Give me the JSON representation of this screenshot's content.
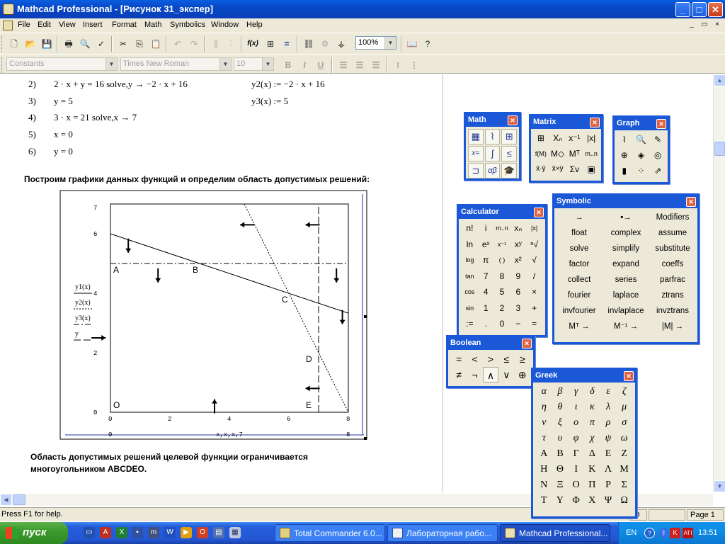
{
  "window": {
    "title": "Mathcad Professional - [Рисунок 31_экспер]",
    "minimize": "_",
    "maximize": "□",
    "close": "✕"
  },
  "menu": [
    "File",
    "Edit",
    "View",
    "Insert",
    "Format",
    "Math",
    "Symbolics",
    "Window",
    "Help"
  ],
  "mdi": {
    "minimize": "_",
    "restore": "▭",
    "close": "×"
  },
  "toolbar": {
    "zoom": "100%",
    "fx_label": "f(x)",
    "equals_label": "="
  },
  "format_bar": {
    "style": "Constants",
    "font": "Times New Roman",
    "size": "10",
    "bold": "B",
    "italic": "I",
    "underline": "U"
  },
  "equations": [
    {
      "num": "2)",
      "expr": "2 · x + y = 16 solve,y  → −2 · x + 16",
      "def": "y2(x) := −2 · x + 16"
    },
    {
      "num": "3)",
      "expr": "y = 5",
      "def": "y3(x) := 5"
    },
    {
      "num": "4)",
      "expr": "3 · x = 21 solve,x  → 7",
      "def": ""
    },
    {
      "num": "5)",
      "expr": "x = 0",
      "def": ""
    },
    {
      "num": "6)",
      "expr": "y = 0",
      "def": ""
    }
  ],
  "heading1": "Построим графики данных функций и определим область допустимых решений:",
  "conclusion": [
    "Область допустимых решений целевой функции ограничивается",
    "многоугольником ABCDEO."
  ],
  "chart_data": {
    "type": "line",
    "xlabel": "x,x,x,7",
    "ylabel_series": [
      "y1(x)",
      "y2(x)",
      "y3(x)",
      "y"
    ],
    "xlim": [
      0,
      8
    ],
    "ylim": [
      0,
      7
    ],
    "x_axis_labels": [
      "0",
      "8"
    ],
    "x_ticks": [
      "0",
      "2",
      "4",
      "6",
      "8"
    ],
    "y_ticks": [
      "0",
      "2",
      "4",
      "6"
    ],
    "y_top": "7",
    "series": [
      {
        "name": "y1(x)",
        "style": "solid",
        "points": [
          [
            0,
            6
          ],
          [
            8,
            3.33
          ]
        ]
      },
      {
        "name": "y2(x)",
        "style": "dotted",
        "points": [
          [
            4.5,
            7
          ],
          [
            8,
            0
          ]
        ]
      },
      {
        "name": "y3(x)",
        "style": "dashdot",
        "points": [
          [
            0,
            5
          ],
          [
            8,
            5
          ]
        ]
      },
      {
        "name": "y",
        "style": "dashed",
        "points": [
          [
            7,
            0
          ],
          [
            7,
            7
          ]
        ]
      }
    ],
    "points": [
      {
        "label": "A",
        "x": 0,
        "y": 5
      },
      {
        "label": "B",
        "x": 3,
        "y": 5
      },
      {
        "label": "C",
        "x": 6,
        "y": 4
      },
      {
        "label": "D",
        "x": 7,
        "y": 2
      },
      {
        "label": "E",
        "x": 7,
        "y": 0
      },
      {
        "label": "O",
        "x": 0,
        "y": 0
      }
    ],
    "arrows": [
      {
        "x": 0.6,
        "y": 5.6,
        "dir": "down"
      },
      {
        "x": 1.6,
        "y": 4.6,
        "dir": "down"
      },
      {
        "x": 4.6,
        "y": 6.3,
        "dir": "left"
      },
      {
        "x": 6.8,
        "y": 6.3,
        "dir": "left"
      },
      {
        "x": 7.6,
        "y": 4.6,
        "dir": "down"
      },
      {
        "x": 7.8,
        "y": 3.2,
        "dir": "down"
      },
      {
        "x": -0.4,
        "y": 2.5,
        "dir": "right"
      },
      {
        "x": 6.8,
        "y": 0.8,
        "dir": "left"
      },
      {
        "x": 3.5,
        "y": 0.2,
        "dir": "up"
      }
    ]
  },
  "palettes": {
    "math": {
      "title": "Math"
    },
    "matrix": {
      "title": "Matrix"
    },
    "graph": {
      "title": "Graph"
    },
    "calculator": {
      "title": "Calculator",
      "keys": [
        "n!",
        "i",
        "m..n",
        "xₙ",
        "|x|",
        "ln",
        "eˣ",
        "x⁻¹",
        "xʸ",
        "ⁿ√",
        "log",
        "π",
        "( )",
        "x²",
        "√",
        "tan",
        "7",
        "8",
        "9",
        "/",
        "cos",
        "4",
        "5",
        "6",
        "×",
        "sin",
        "1",
        "2",
        "3",
        "+",
        ":=",
        ".",
        "0",
        "−",
        "="
      ]
    },
    "symbolic": {
      "title": "Symbolic",
      "keys": [
        "→",
        "▪→",
        "Modifiers",
        "float",
        "complex",
        "assume",
        "solve",
        "simplify",
        "substitute",
        "factor",
        "expand",
        "coeffs",
        "collect",
        "series",
        "parfrac",
        "fourier",
        "laplace",
        "ztrans",
        "invfourier",
        "invlaplace",
        "invztrans",
        "Mᵀ →",
        "M⁻¹ →",
        "|M| →"
      ]
    },
    "boolean": {
      "title": "Boolean",
      "keys": [
        "=",
        "<",
        ">",
        "≤",
        "≥",
        "≠",
        "¬",
        "∧",
        "∨",
        "⊕"
      ]
    },
    "greek": {
      "title": "Greek",
      "lower": [
        "α",
        "β",
        "γ",
        "δ",
        "ε",
        "ζ",
        "η",
        "θ",
        "ι",
        "κ",
        "λ",
        "μ",
        "ν",
        "ξ",
        "ο",
        "π",
        "ρ",
        "σ",
        "τ",
        "υ",
        "φ",
        "χ",
        "ψ",
        "ω"
      ],
      "upper": [
        "Α",
        "Β",
        "Γ",
        "Δ",
        "Ε",
        "Ζ",
        "Η",
        "Θ",
        "Ι",
        "Κ",
        "Λ",
        "Μ",
        "Ν",
        "Ξ",
        "Ο",
        "Π",
        "Ρ",
        "Σ",
        "Τ",
        "Υ",
        "Φ",
        "Χ",
        "Ψ",
        "Ω"
      ]
    }
  },
  "status": {
    "help": "Press F1 for help.",
    "mode": "O",
    "page": "Page 1"
  },
  "taskbar": {
    "start": "пуск",
    "tasks": [
      "Total Commander 6.0...",
      "Лабораторная рабо...",
      "Mathcad Professional..."
    ],
    "lang": "EN",
    "clock": "13:51"
  }
}
